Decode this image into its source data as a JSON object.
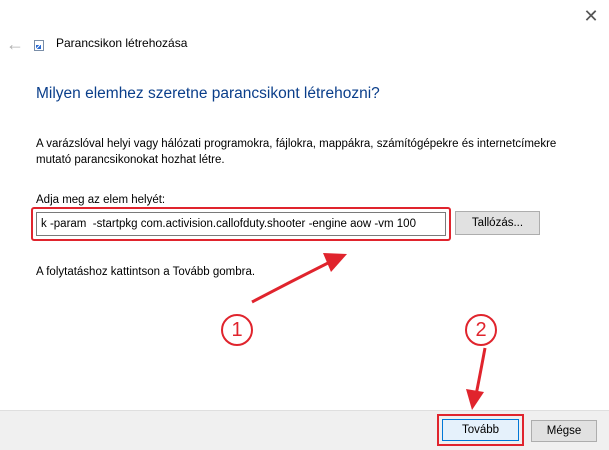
{
  "window": {
    "title": "Parancsikon létrehozása",
    "close_glyph": "✕",
    "back_glyph": "←"
  },
  "main": {
    "heading": "Milyen elemhez szeretne parancsikont létrehozni?",
    "description": "A varázslóval helyi vagy hálózati programokra, fájlokra, mappákra, számítógépekre és internetcímekre mutató parancsikonokat hozhat létre.",
    "location_label": "Adja meg az elem helyét:",
    "location_value": "k -param  -startpkg com.activision.callofduty.shooter -engine aow -vm 100",
    "browse_label": "Tallózás...",
    "hint": "A folytatáshoz kattintson a Tovább gombra."
  },
  "annotations": {
    "marker_1": "1",
    "marker_2": "2",
    "color": "#e0242d"
  },
  "footer": {
    "next_label": "Tovább",
    "cancel_label": "Mégse"
  },
  "icons": {
    "close": "close-icon",
    "back": "back-arrow-icon",
    "shortcut": "shortcut-icon"
  }
}
